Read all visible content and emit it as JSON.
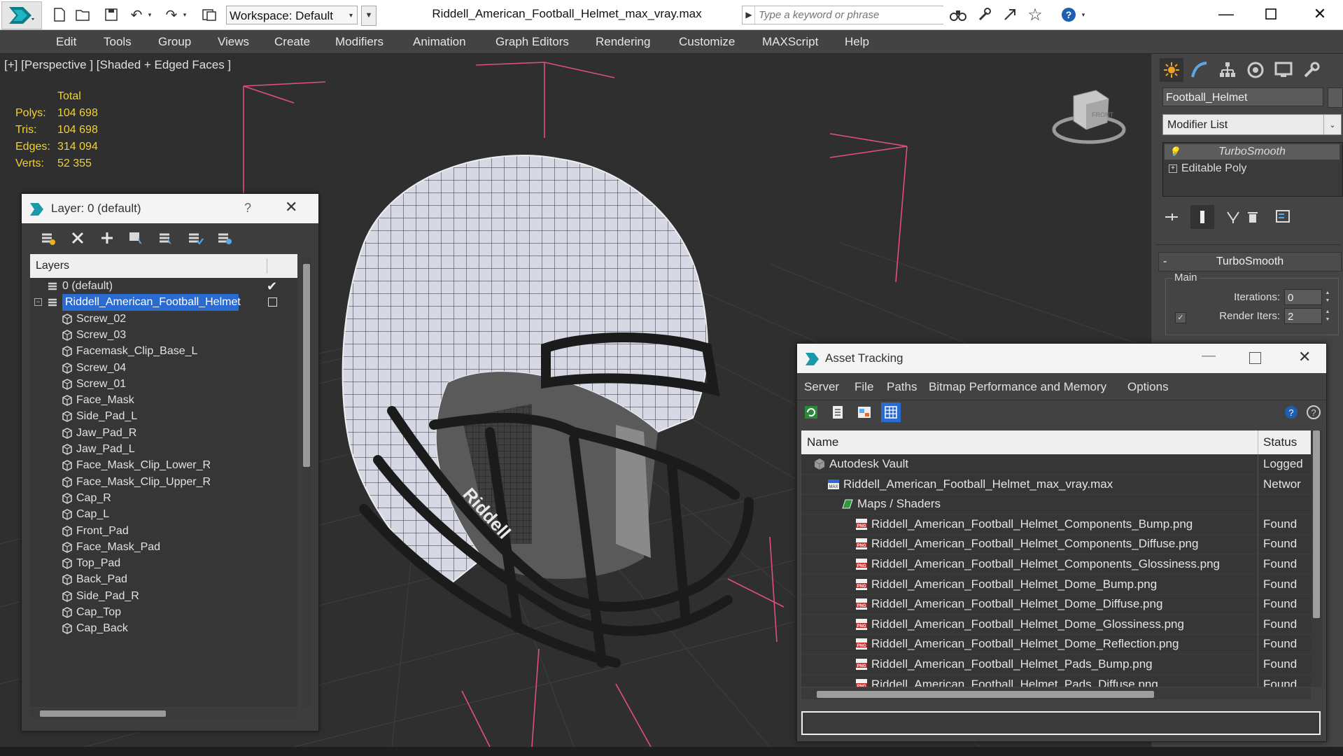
{
  "titlebar": {
    "workspace": "Workspace: Default",
    "document_title": "Riddell_American_Football_Helmet_max_vray.max",
    "search_placeholder": "Type a keyword or phrase"
  },
  "menu": [
    "Edit",
    "Tools",
    "Group",
    "Views",
    "Create",
    "Modifiers",
    "Animation",
    "Graph Editors",
    "Rendering",
    "Customize",
    "MAXScript",
    "Help"
  ],
  "viewport": {
    "label": "[+] [Perspective ] [Shaded + Edged Faces ]",
    "stats": {
      "header": "Total",
      "polys_label": "Polys:",
      "polys": "104 698",
      "tris_label": "Tris:",
      "tris": "104 698",
      "edges_label": "Edges:",
      "edges": "314 094",
      "verts_label": "Verts:",
      "verts": "52 355"
    },
    "viewcube_face": "FRONT"
  },
  "command_panel": {
    "object_name": "Football_Helmet",
    "modifier_list": "Modifier List",
    "stack": [
      "TurboSmooth",
      "Editable Poly"
    ],
    "rollout_title": "TurboSmooth",
    "group_main": "Main",
    "iterations_label": "Iterations:",
    "iterations": "0",
    "render_iters_label": "Render Iters:",
    "render_iters": "2"
  },
  "layer_panel": {
    "title": "Layer: 0 (default)",
    "help": "?",
    "header": "Layers",
    "layers": [
      "0 (default)",
      "Riddell_American_Football_Helmet",
      "Screw_02",
      "Screw_03",
      "Facemask_Clip_Base_L",
      "Screw_04",
      "Screw_01",
      "Face_Mask",
      "Side_Pad_L",
      "Jaw_Pad_R",
      "Jaw_Pad_L",
      "Face_Mask_Clip_Lower_R",
      "Face_Mask_Clip_Upper_R",
      "Cap_R",
      "Cap_L",
      "Front_Pad",
      "Face_Mask_Pad",
      "Top_Pad",
      "Back_Pad",
      "Side_Pad_R",
      "Cap_Top",
      "Cap_Back"
    ]
  },
  "asset_tracking": {
    "title": "Asset Tracking",
    "menu": [
      "Server",
      "File",
      "Paths",
      "Bitmap Performance and Memory",
      "Options"
    ],
    "col_name": "Name",
    "col_status": "Status",
    "rows": [
      {
        "name": "Autodesk Vault",
        "status": "Logged"
      },
      {
        "name": "Riddell_American_Football_Helmet_max_vray.max",
        "status": "Networ"
      },
      {
        "name": "Maps / Shaders",
        "status": ""
      },
      {
        "name": "Riddell_American_Football_Helmet_Components_Bump.png",
        "status": "Found"
      },
      {
        "name": "Riddell_American_Football_Helmet_Components_Diffuse.png",
        "status": "Found"
      },
      {
        "name": "Riddell_American_Football_Helmet_Components_Glossiness.png",
        "status": "Found"
      },
      {
        "name": "Riddell_American_Football_Helmet_Dome_Bump.png",
        "status": "Found"
      },
      {
        "name": "Riddell_American_Football_Helmet_Dome_Diffuse.png",
        "status": "Found"
      },
      {
        "name": "Riddell_American_Football_Helmet_Dome_Glossiness.png",
        "status": "Found"
      },
      {
        "name": "Riddell_American_Football_Helmet_Dome_Reflection.png",
        "status": "Found"
      },
      {
        "name": "Riddell_American_Football_Helmet_Pads_Bump.png",
        "status": "Found"
      },
      {
        "name": "Riddell_American_Football_Helmet_Pads_Diffuse.png",
        "status": "Found"
      }
    ]
  },
  "colors": {
    "selection": "#2a6bd1",
    "stats_text": "#f2d22e",
    "grid_pink": "#e0507a",
    "viewport_bg": "#2f2f2f"
  }
}
